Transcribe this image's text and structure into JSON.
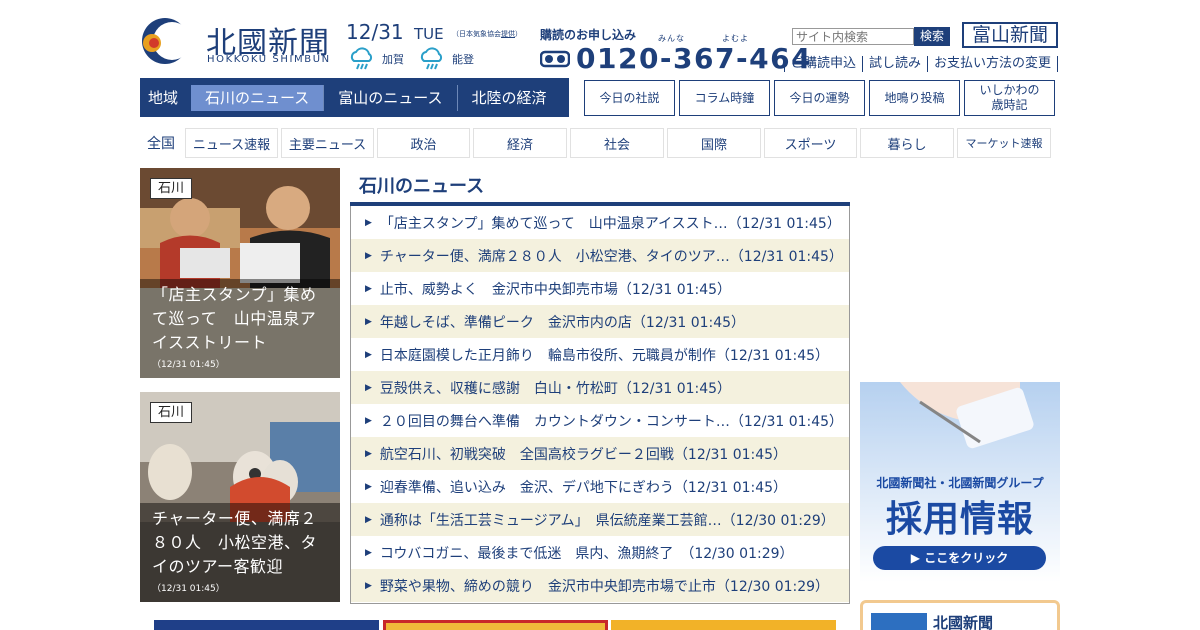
{
  "logo": {
    "title": "北國新聞",
    "subtitle": "HOKKOKU SHIMBUN"
  },
  "date": {
    "day": "12/31",
    "dow": "TUE",
    "note_prefix": "（日本気象協会",
    "note_link": "提供",
    "note_suffix": "）"
  },
  "weather": [
    {
      "label": "加賀",
      "icon": "rain-cloud-icon"
    },
    {
      "label": "能登",
      "icon": "rain-cloud-icon"
    }
  ],
  "subscribe": {
    "title": "購読のお申し込み",
    "ruby_1": "みんな",
    "ruby_2": "よむよ",
    "phone": "0120-367-464"
  },
  "search": {
    "placeholder": "サイト内検索",
    "button": "検索"
  },
  "toyama_button": "富山新聞",
  "top_links": [
    "ご購読申込",
    "試し読み",
    "お支払い方法の変更"
  ],
  "region_nav": {
    "label": "地域",
    "items": [
      {
        "label": "石川のニュース",
        "active": true
      },
      {
        "label": "富山のニュース",
        "active": false
      },
      {
        "label": "北陸の経済",
        "active": false
      }
    ]
  },
  "column_buttons": [
    "今日の社説",
    "コラム時鐘",
    "今日の運勢",
    "地鳴り投稿",
    "いしかわの",
    "歳時記"
  ],
  "category_nav": {
    "all": "全国",
    "items": [
      "ニュース速報",
      "主要ニュース",
      "政治",
      "経済",
      "社会",
      "国際",
      "スポーツ",
      "暮らし",
      "マーケット速報"
    ]
  },
  "cards": [
    {
      "tag": "石川",
      "title": "「店主スタンプ」集めて巡って　山中温泉アイスストリート",
      "time": "（12/31 01:45）"
    },
    {
      "tag": "石川",
      "title": "チャーター便、満席２８０人　小松空港、タイのツアー客歓迎",
      "time": "（12/31 01:45）"
    }
  ],
  "news": {
    "heading": "石川のニュース",
    "items": [
      "「店主スタンプ」集めて巡って　山中温泉アイススト…（12/31 01:45）",
      "チャーター便、満席２８０人　小松空港、タイのツア…（12/31 01:45）",
      "止市、威勢よく　金沢市中央卸売市場（12/31 01:45）",
      "年越しそば、準備ピーク　金沢市内の店（12/31 01:45）",
      "日本庭園模した正月飾り　輪島市役所、元職員が制作（12/31 01:45）",
      "豆殻供え、収穫に感謝　白山・竹松町（12/31 01:45）",
      "２０回目の舞台へ準備　カウントダウン・コンサート…（12/31 01:45）",
      "航空石川、初戦突破　全国高校ラグビー２回戦（12/31 01:45）",
      "迎春準備、追い込み　金沢、デパ地下にぎわう（12/31 01:45）",
      "通称は「生活工芸ミュージアム」　県伝統産業工芸館…（12/30 01:29）",
      "コウバコガニ、最後まで低迷　県内、漁期終了　（12/30 01:29）",
      "野菜や果物、締めの競り　金沢市中央卸売市場で止市（12/30 01:29）"
    ]
  },
  "ad": {
    "sub": "北國新聞社・北國新聞グループ",
    "main": "採用情報",
    "button": "▶ ここをクリック"
  },
  "promo": {
    "title": "北國新聞"
  },
  "colors": {
    "brand": "#1e3f7a",
    "active_tab": "#6f8fcf",
    "row_alt": "#f4f1de",
    "ad_blue": "#1b4aa3"
  }
}
